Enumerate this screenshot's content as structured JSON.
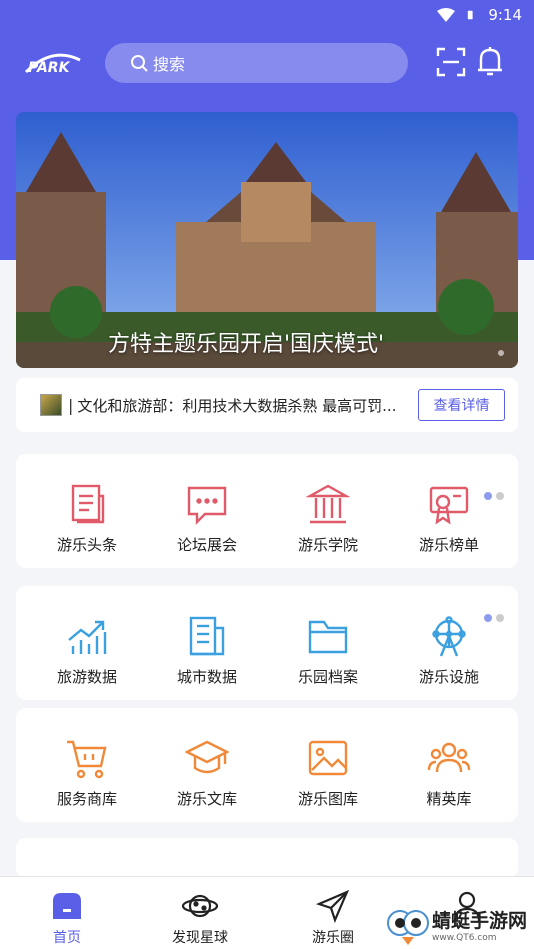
{
  "status": {
    "time": "9:14"
  },
  "header": {
    "logo_text": "PARK",
    "search_placeholder": "搜索"
  },
  "banner": {
    "caption": "方特主题乐园开启'国庆模式'"
  },
  "news": {
    "text": "文化和旅游部：利用技术大数据杀熟 最高可罚...",
    "button": "查看详情"
  },
  "grid1": {
    "items": [
      {
        "label": "游乐头条",
        "icon": "newspaper-icon"
      },
      {
        "label": "论坛展会",
        "icon": "chat-bubble-icon"
      },
      {
        "label": "游乐学院",
        "icon": "academy-building-icon"
      },
      {
        "label": "游乐榜单",
        "icon": "certificate-icon"
      }
    ]
  },
  "grid2": {
    "items": [
      {
        "label": "旅游数据",
        "icon": "chart-trend-icon"
      },
      {
        "label": "城市数据",
        "icon": "city-document-icon"
      },
      {
        "label": "乐园档案",
        "icon": "folder-icon"
      },
      {
        "label": "游乐设施",
        "icon": "ferris-wheel-icon"
      }
    ]
  },
  "grid3": {
    "items": [
      {
        "label": "服务商库",
        "icon": "shopping-cart-icon"
      },
      {
        "label": "游乐文库",
        "icon": "graduation-cap-icon"
      },
      {
        "label": "游乐图库",
        "icon": "picture-icon"
      },
      {
        "label": "精英库",
        "icon": "people-group-icon"
      }
    ]
  },
  "tabbar": {
    "items": [
      {
        "label": "首页"
      },
      {
        "label": "发现星球"
      },
      {
        "label": "游乐圈"
      },
      {
        "label": ""
      }
    ]
  },
  "watermark": {
    "title": "蜻蜓手游网",
    "url": "www.QT6.com"
  },
  "colors": {
    "primary": "#5a5fe8",
    "red": "#e05a6a",
    "blue": "#3aa0e0",
    "orange": "#f08a3a"
  }
}
